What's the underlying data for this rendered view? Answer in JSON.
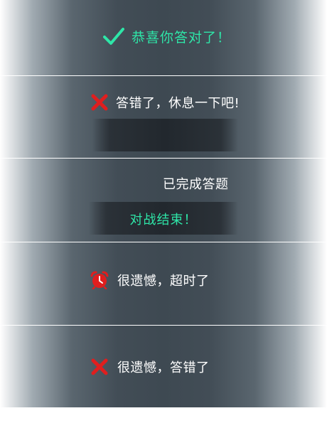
{
  "panels": {
    "correct": {
      "text": "恭喜你答对了！",
      "icon": "checkmark-icon",
      "color": "#2ee6a8"
    },
    "wrong_rest": {
      "text": "答错了，休息一下吧!",
      "icon": "cross-icon",
      "color": "#e01e1e"
    },
    "completed": {
      "status_text": "已完成答题",
      "battle_end_text": "对战结束！",
      "color": "#2ee6a8"
    },
    "timeout": {
      "text": "很遗憾，超时了",
      "icon": "alarm-clock-icon",
      "color": "#e01e1e"
    },
    "wrong": {
      "text": "很遗憾，答错了",
      "icon": "cross-icon",
      "color": "#e01e1e"
    }
  }
}
